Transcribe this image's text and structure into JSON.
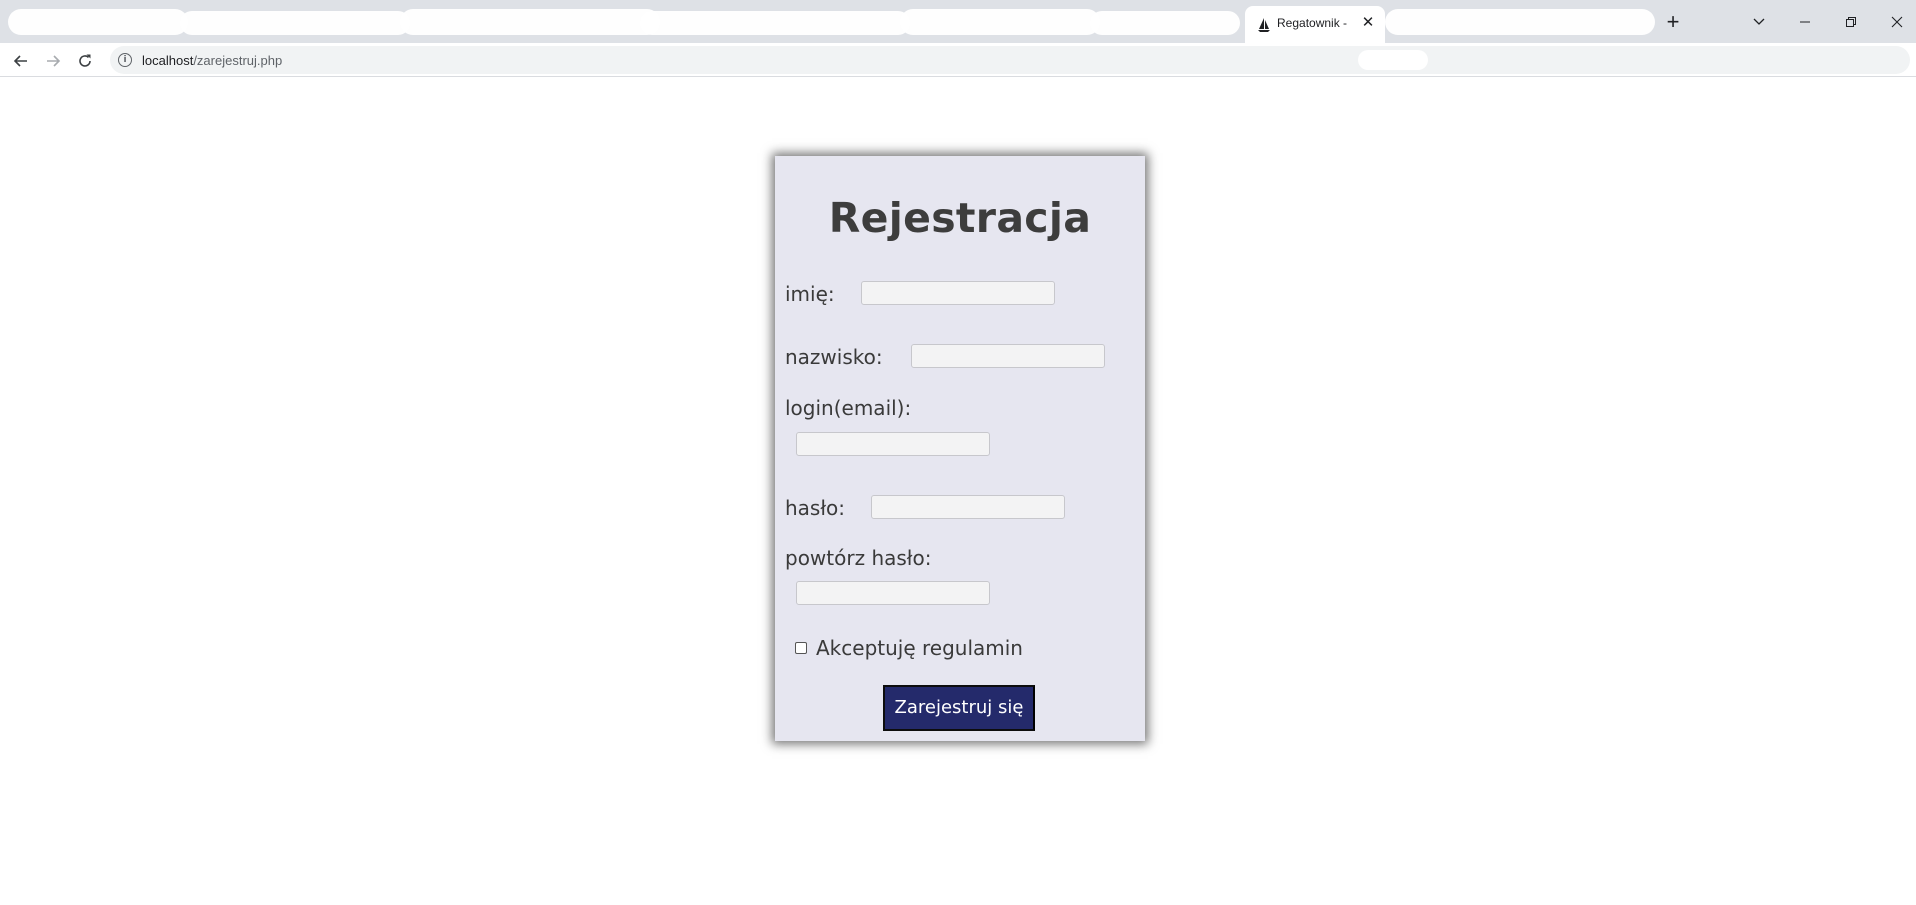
{
  "browser": {
    "active_tab_title": "Regatownik -",
    "new_tab_symbol": "+",
    "tab_close_symbol": "✕",
    "url_host": "localhost",
    "url_path": "/zarejestruj.php",
    "icons": {
      "back": "arrow-left-icon",
      "forward": "arrow-right-icon",
      "reload": "reload-icon",
      "site_info": "info-icon",
      "favicon": "sailboat-icon",
      "tab_search": "chevron-down-icon",
      "minimize": "minimize-icon",
      "restore": "restore-icon",
      "close": "close-icon"
    }
  },
  "form": {
    "title": "Rejestracja",
    "fields": {
      "first_name": {
        "label": "imię:",
        "value": ""
      },
      "last_name": {
        "label": "nazwisko:",
        "value": ""
      },
      "login": {
        "label": "login(email):",
        "value": ""
      },
      "password": {
        "label": "hasło:",
        "value": ""
      },
      "password_repeat": {
        "label": "powtórz hasło:",
        "value": ""
      }
    },
    "terms": {
      "label": "Akceptuję regulamin",
      "checked": false
    },
    "submit_label": "Zarejestruj się"
  },
  "colors": {
    "card_background": "#e6e6f0",
    "submit_background": "#242a6b",
    "chrome_background": "#dee1e6"
  }
}
